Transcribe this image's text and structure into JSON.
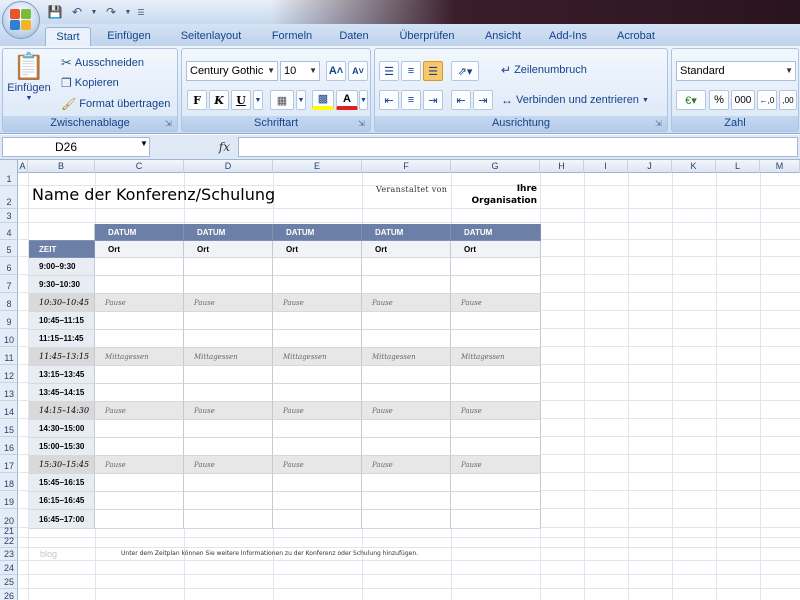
{
  "app": {
    "tabs": [
      "Start",
      "Einfügen",
      "Seitenlayout",
      "Formeln",
      "Daten",
      "Überprüfen",
      "Ansicht",
      "Add-Ins",
      "Acrobat"
    ],
    "active_tab": "Start"
  },
  "ribbon": {
    "clipboard": {
      "label": "Zwischenablage",
      "paste": "Einfügen",
      "cut": "Ausschneiden",
      "copy": "Kopieren",
      "format_painter": "Format übertragen"
    },
    "font": {
      "label": "Schriftart",
      "font_name": "Century Gothic",
      "font_size": "10",
      "bold": "F",
      "italic": "K",
      "underline": "U"
    },
    "alignment": {
      "label": "Ausrichtung",
      "wrap_text": "Zeilenumbruch",
      "merge_center": "Verbinden und zentrieren"
    },
    "number": {
      "label": "Zahl",
      "format": "Standard",
      "percent": "%",
      "thousands": "000"
    }
  },
  "formula_bar": {
    "name_box": "D26",
    "fx": "fx",
    "content": ""
  },
  "grid": {
    "columns": [
      "A",
      "B",
      "C",
      "D",
      "E",
      "F",
      "G",
      "H",
      "I",
      "J",
      "K",
      "L",
      "M"
    ],
    "rows": [
      "1",
      "2",
      "3",
      "4",
      "5",
      "6",
      "7",
      "8",
      "9",
      "10",
      "11",
      "12",
      "13",
      "14",
      "15",
      "16",
      "17",
      "18",
      "19",
      "20",
      "21",
      "22",
      "23",
      "24",
      "25",
      "26"
    ]
  },
  "sheet": {
    "title": "Name der Konferenz/Schulung",
    "organizer_label": "Veranstaltet von",
    "organizer_name_line1": "Ihre",
    "organizer_name_line2": "Organisation",
    "watermark": "blog",
    "footer_note": "Unter dem Zeitplan können Sie weitere Informationen zu der Konferenz oder Schulung hinzufügen."
  },
  "schedule": {
    "date_header": "DATUM",
    "location": "Ort",
    "time_header": "ZEIT",
    "day_count_label": [
      "DATUM",
      "DATUM",
      "DATUM",
      "DATUM",
      "DATUM"
    ],
    "rows": [
      {
        "time": "9:00–9:30",
        "type": "slot",
        "label": ""
      },
      {
        "time": "9:30–10:30",
        "type": "slot",
        "label": ""
      },
      {
        "time": "10:30–10:45",
        "type": "break",
        "label": "Pause"
      },
      {
        "time": "10:45–11:15",
        "type": "slot",
        "label": ""
      },
      {
        "time": "11:15–11:45",
        "type": "slot",
        "label": ""
      },
      {
        "time": "11:45–13:15",
        "type": "break",
        "label": "Mittagessen"
      },
      {
        "time": "13:15–13:45",
        "type": "slot",
        "label": ""
      },
      {
        "time": "13:45–14:15",
        "type": "slot",
        "label": ""
      },
      {
        "time": "14:15–14:30",
        "type": "break",
        "label": "Pause"
      },
      {
        "time": "14:30–15:00",
        "type": "slot",
        "label": ""
      },
      {
        "time": "15:00–15:30",
        "type": "slot",
        "label": ""
      },
      {
        "time": "15:30–15:45",
        "type": "break",
        "label": "Pause"
      },
      {
        "time": "15:45–16:15",
        "type": "slot",
        "label": ""
      },
      {
        "time": "16:15–16:45",
        "type": "slot",
        "label": ""
      },
      {
        "time": "16:45–17:00",
        "type": "slot",
        "label": ""
      }
    ]
  },
  "colors": {
    "header_blue": "#6c7fa6",
    "ribbon_text": "#15428b",
    "break_gray": "#e7e7e7"
  }
}
